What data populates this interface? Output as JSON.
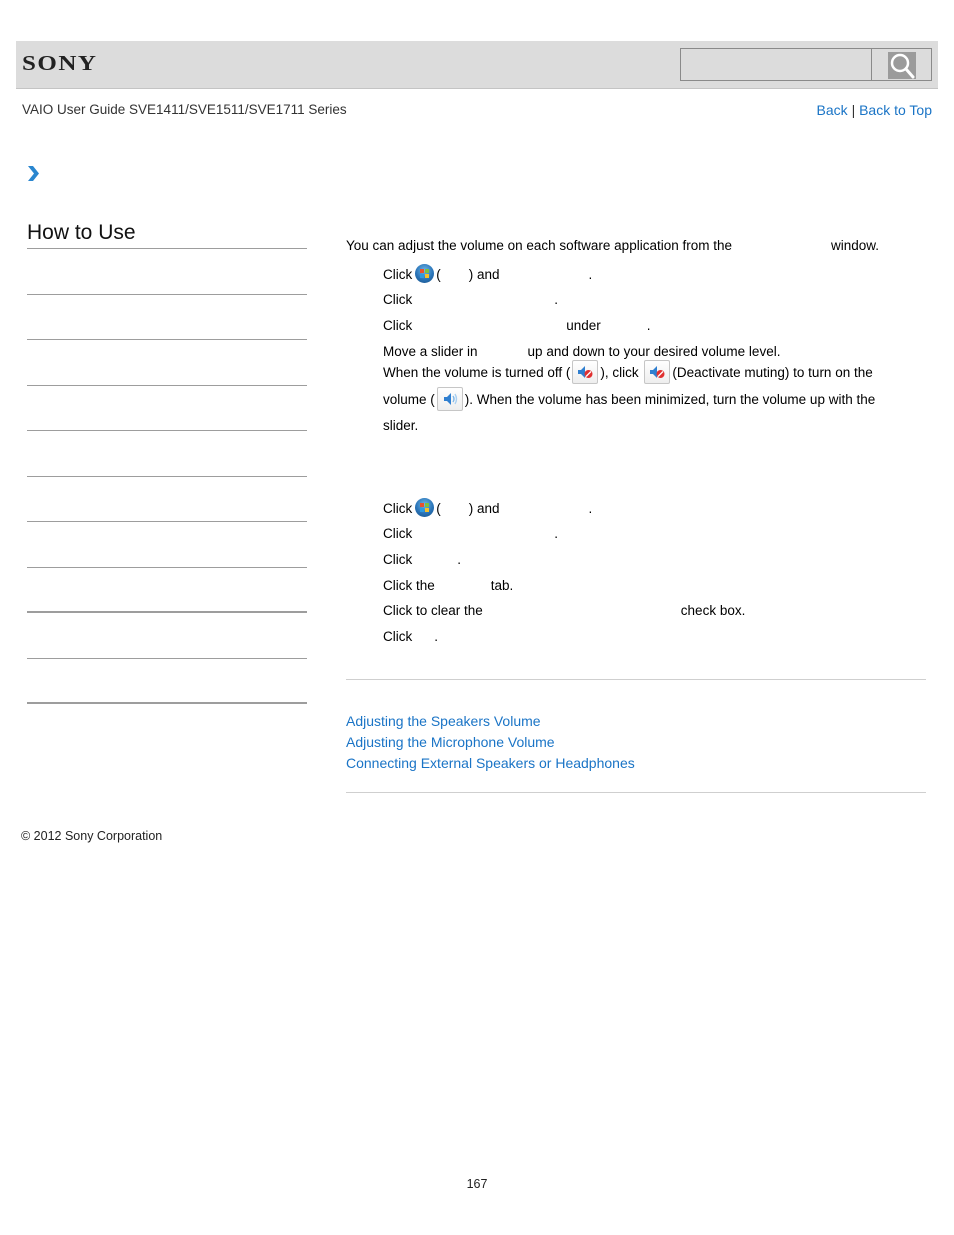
{
  "header": {
    "logo": "SONY",
    "search": {
      "placeholder": "",
      "value": "",
      "button_icon": "search-icon"
    },
    "guide_title": "VAIO User Guide SVE1411/SVE1511/SVE1711 Series",
    "links": {
      "back": "Back",
      "separator": "|",
      "back_to_top": "Back to Top"
    }
  },
  "breadcrumb": {
    "icon": "chevron-right-icon"
  },
  "sidebar": {
    "title": "How to Use",
    "item_count": 10
  },
  "content": {
    "intro": {
      "before": "You can adjust the volume on each software application from the",
      "after": "window."
    },
    "section1": {
      "steps": [
        {
          "parts": [
            "Click",
            "(",
            ") and",
            "."
          ],
          "icon": "windows-start-icon"
        },
        {
          "parts": [
            "Click",
            "."
          ]
        },
        {
          "parts": [
            "Click",
            "under",
            "."
          ]
        },
        {
          "parts": [
            "Move a slider in",
            "up and down to your desired volume level."
          ]
        }
      ],
      "note": {
        "t1": "When the volume is turned off (",
        "t2": "), click",
        "t3": "(Deactivate muting) to turn on the volume (",
        "t4": "). When the volume has been minimized, turn the volume up with the slider.",
        "icons": [
          "muted-speaker-icon",
          "deactivate-muting-icon",
          "speaker-on-icon"
        ]
      }
    },
    "section2": {
      "steps": [
        {
          "parts": [
            "Click",
            "(",
            ") and",
            "."
          ],
          "icon": "windows-start-icon"
        },
        {
          "parts": [
            "Click",
            "."
          ]
        },
        {
          "parts": [
            "Click",
            "."
          ]
        },
        {
          "parts": [
            "Click the",
            "tab."
          ]
        },
        {
          "parts": [
            "Click to clear the",
            "check box."
          ]
        },
        {
          "parts": [
            "Click",
            "."
          ]
        }
      ]
    },
    "related_links": [
      "Adjusting the Speakers Volume",
      "Adjusting the Microphone Volume",
      "Connecting External Speakers or Headphones"
    ]
  },
  "footer": {
    "copyright": "© 2012 Sony Corporation",
    "page_number": "167"
  },
  "colors": {
    "link": "#1a74c6",
    "header_bg": "#dcdcdc",
    "rule": "#9d9d9d"
  }
}
